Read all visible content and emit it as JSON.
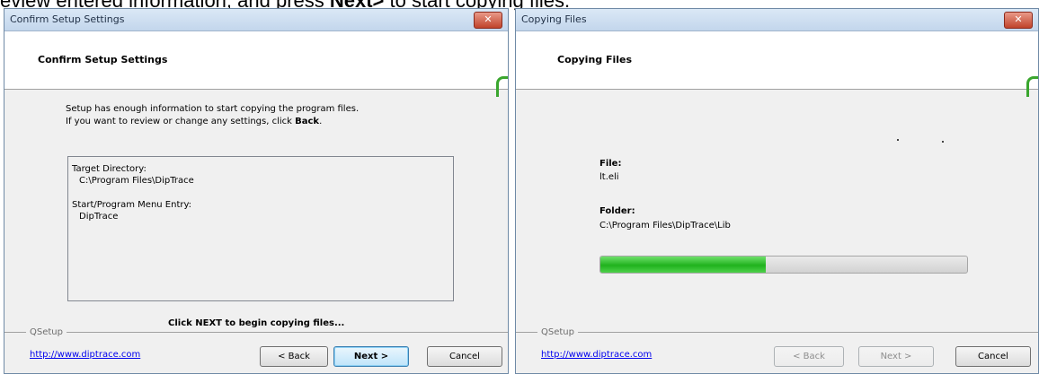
{
  "caption": {
    "prefix": "eview entered information, and press ",
    "next_word": "Next>",
    "suffix": " to start copying files."
  },
  "left_window": {
    "title": "Confirm Setup Settings",
    "close_label": "✕",
    "header_title": "Confirm Setup Settings",
    "body_line1": "Setup has enough information to start copying the program files.",
    "body_line2_prefix": "If you want to review or change any settings, click ",
    "body_line2_bold": "Back",
    "body_line2_suffix": ".",
    "summary": {
      "target_label": "Target Directory:",
      "target_value": "C:\\Program Files\\DipTrace",
      "menu_label": "Start/Program Menu Entry:",
      "menu_value": "DipTrace"
    },
    "click_next_text": "Click NEXT to begin copying files...",
    "group_label": "QSetup",
    "link": "http://www.diptrace.com",
    "buttons": {
      "back": "< Back",
      "next": "Next >",
      "cancel": "Cancel"
    }
  },
  "right_window": {
    "title": "Copying Files",
    "close_label": "✕",
    "header_title": "Copying Files",
    "file_label": "File:",
    "file_value": "lt.eli",
    "folder_label": "Folder:",
    "folder_value": "C:\\Program Files\\DipTrace\\Lib",
    "progress_fraction": 0.45,
    "group_label": "QSetup",
    "link": "http://www.diptrace.com",
    "buttons": {
      "back": "< Back",
      "next": "Next >",
      "cancel": "Cancel"
    }
  },
  "colors": {
    "progress_fill": "#20b21d",
    "link": "#0000ee",
    "close_button": "#c0432b"
  }
}
